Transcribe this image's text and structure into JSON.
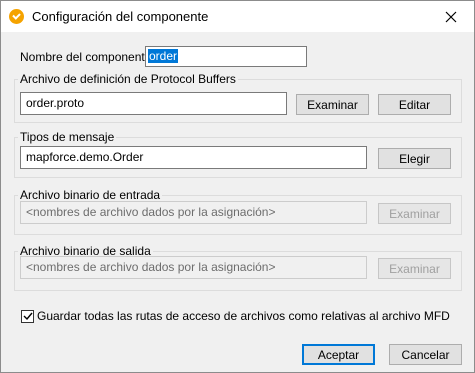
{
  "window": {
    "title": "Configuración del componente",
    "icon": "mapforce-app-icon"
  },
  "component_name": {
    "label": "Nombre del componente:",
    "value": "order"
  },
  "definition_file": {
    "group_title": "Archivo de definición de Protocol Buffers",
    "value": "order.proto",
    "browse_label": "Examinar",
    "edit_label": "Editar"
  },
  "message_types": {
    "group_title": "Tipos de mensaje",
    "value": "mapforce.demo.Order",
    "choose_label": "Elegir"
  },
  "input_binary": {
    "group_title": "Archivo binario de entrada",
    "placeholder": "<nombres de archivo dados por la asignación>",
    "browse_label": "Examinar"
  },
  "output_binary": {
    "group_title": "Archivo binario de salida",
    "placeholder": "<nombres de archivo dados por la asignación>",
    "browse_label": "Examinar"
  },
  "relative_paths": {
    "label": "Guardar todas las rutas de acceso de archivos como relativas al archivo MFD",
    "checked": true
  },
  "footer": {
    "accept_label": "Aceptar",
    "cancel_label": "Cancelar"
  }
}
